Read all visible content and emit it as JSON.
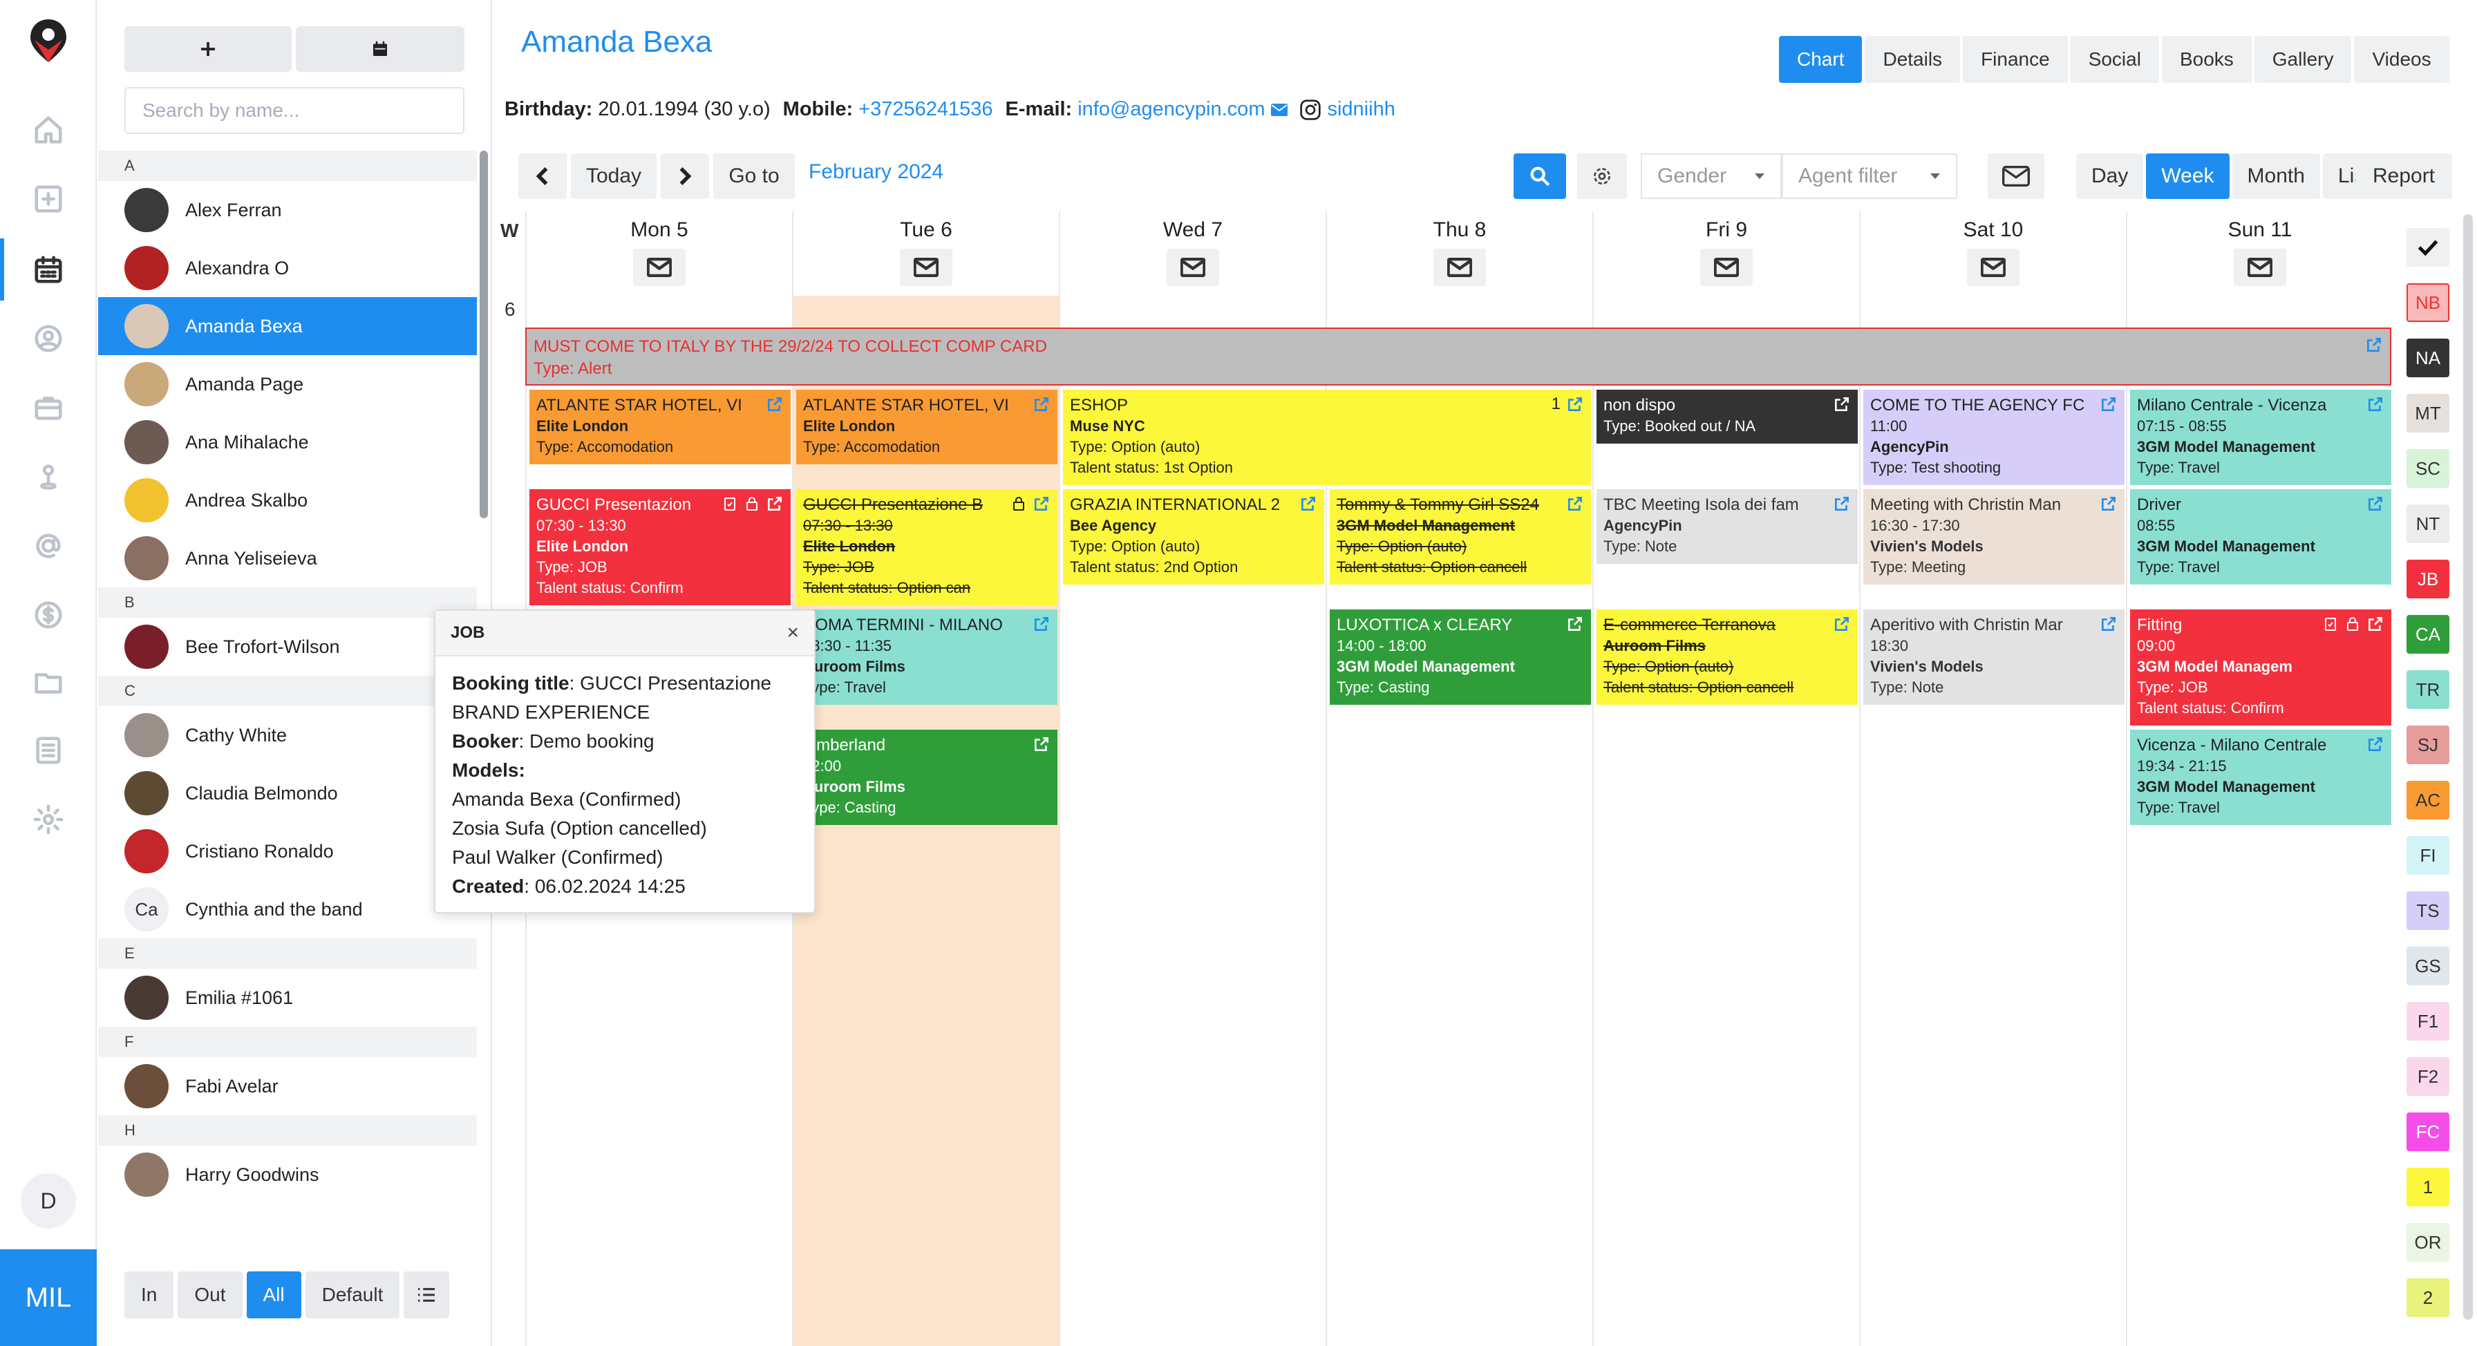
{
  "model_name": "Amanda Bexa",
  "view_tabs": [
    "Chart",
    "Details",
    "Finance",
    "Social",
    "Books",
    "Gallery",
    "Videos"
  ],
  "info": {
    "birthday_label": "Birthday:",
    "birthday": "20.01.1994 (30 y.o)",
    "mobile_label": "Mobile:",
    "mobile": "+37256241536",
    "email_label": "E-mail:",
    "email": "info@agencypin.com",
    "instagram": "sidniihh"
  },
  "sidebar": {
    "search_placeholder": "Search by name...",
    "groups": [
      {
        "letter": "A",
        "models": [
          {
            "name": "Alex Ferran",
            "color": "#3a3a3a"
          },
          {
            "name": "Alexandra O",
            "color": "#b22222"
          },
          {
            "name": "Amanda Bexa",
            "color": "#d9c8b8",
            "selected": true
          },
          {
            "name": "Amanda Page",
            "color": "#c9a87a"
          },
          {
            "name": "Ana Mihalache",
            "color": "#6d5a52"
          },
          {
            "name": "Andrea Skalbo",
            "color": "#f2c12e"
          },
          {
            "name": "Anna Yeliseieva",
            "color": "#8a6f63"
          }
        ]
      },
      {
        "letter": "B",
        "models": [
          {
            "name": "Bee Trofort-Wilson",
            "color": "#7a1f2a"
          }
        ]
      },
      {
        "letter": "C",
        "models": [
          {
            "name": "Cathy White",
            "color": "#9b8f8a"
          },
          {
            "name": "Claudia Belmondo",
            "color": "#5c4a32"
          },
          {
            "name": "Cristiano Ronaldo",
            "color": "#c3272b"
          },
          {
            "name": "Cynthia and the band",
            "initials": "Ca",
            "color": "#eef0f3"
          }
        ]
      },
      {
        "letter": "E",
        "models": [
          {
            "name": "Emilia #1061",
            "color": "#4a3a34"
          }
        ]
      },
      {
        "letter": "F",
        "models": [
          {
            "name": "Fabi Avelar",
            "color": "#6b4f3a"
          }
        ]
      },
      {
        "letter": "H",
        "models": [
          {
            "name": "Harry Goodwins",
            "color": "#8f7666"
          }
        ]
      }
    ],
    "filters": [
      "In",
      "Out",
      "All",
      "Default"
    ],
    "active_filter": "All"
  },
  "rail": {
    "user_initial": "D",
    "office": "MIL"
  },
  "toolbar": {
    "today": "Today",
    "goto": "Go to",
    "month": "February 2024",
    "gender_placeholder": "Gender",
    "agent_placeholder": "Agent filter",
    "views": [
      "Day",
      "Week",
      "Month",
      "List"
    ],
    "active_view": "Week",
    "report": "Report"
  },
  "calendar": {
    "week_letter": "W",
    "week_number": "6",
    "days": [
      "Mon 5",
      "Tue 6",
      "Wed 7",
      "Thu 8",
      "Fri 9",
      "Sat 10",
      "Sun 11"
    ],
    "alert": {
      "title": "MUST COME TO ITALY BY THE 29/2/24 TO COLLECT COMP CARD",
      "type": "Type: Alert"
    },
    "events": [
      {
        "day": 0,
        "slot": 0,
        "cls": "c-orange",
        "lines": [
          "ATLANTE STAR HOTEL, VI",
          "Elite London",
          "Type: Accomodation"
        ],
        "bold": [
          1
        ]
      },
      {
        "day": 1,
        "slot": 0,
        "cls": "c-orange",
        "lines": [
          "ATLANTE STAR HOTEL, VI",
          "Elite London",
          "Type: Accomodation"
        ],
        "bold": [
          1
        ]
      },
      {
        "day": 2,
        "slot": 0,
        "cls": "c-yellow",
        "wide": true,
        "lines": [
          "ESHOP",
          "Muse NYC",
          "Type: Option (auto)",
          "Talent status: 1st Option"
        ],
        "bold": [
          1
        ],
        "badge": "1"
      },
      {
        "day": 4,
        "slot": 0,
        "cls": "c-black",
        "lines": [
          "non dispo",
          "Type: Booked out / NA"
        ]
      },
      {
        "day": 5,
        "slot": 0,
        "cls": "c-lav",
        "lines": [
          "COME TO THE AGENCY FC",
          "11:00",
          "AgencyPin",
          "Type: Test shooting"
        ],
        "bold": [
          2
        ]
      },
      {
        "day": 6,
        "slot": 0,
        "cls": "c-teal",
        "lines": [
          "Milano Centrale - Vicenza",
          "07:15 - 08:55",
          "3GM Model Management",
          "Type: Travel"
        ],
        "bold": [
          2
        ]
      },
      {
        "day": 0,
        "slot": 1,
        "cls": "c-red",
        "lines": [
          "GUCCI Presentazion",
          "07:30 - 13:30",
          "Elite London",
          "Type: JOB",
          "Talent status: Confirm"
        ],
        "bold": [
          2
        ],
        "icons": true
      },
      {
        "day": 1,
        "slot": 1,
        "cls": "c-yellow",
        "strike": true,
        "lines": [
          "GUCCI Presentazione B",
          "07:30 - 13:30",
          "Elite London",
          "Type: JOB",
          "Talent status: Option can"
        ],
        "bold": [
          2
        ],
        "lock": true
      },
      {
        "day": 2,
        "slot": 1,
        "cls": "c-yellow",
        "lines": [
          "GRAZIA INTERNATIONAL 2",
          "Bee Agency",
          "Type: Option (auto)",
          "Talent status: 2nd Option"
        ],
        "bold": [
          1
        ]
      },
      {
        "day": 3,
        "slot": 1,
        "cls": "c-yellow",
        "strike": true,
        "lines": [
          "Tommy & Tommy Girl SS24",
          "3GM Model Management",
          "Type: Option (auto)",
          "Talent status: Option cancell"
        ],
        "bold": [
          1
        ]
      },
      {
        "day": 4,
        "slot": 1,
        "cls": "c-grey",
        "lines": [
          "TBC Meeting Isola dei fam",
          "AgencyPin",
          "Type: Note"
        ],
        "bold": [
          1
        ]
      },
      {
        "day": 5,
        "slot": 1,
        "cls": "c-beige",
        "lines": [
          "Meeting with Christin Man",
          "16:30 - 17:30",
          "Vivien's Models",
          "Type: Meeting"
        ],
        "bold": [
          2
        ]
      },
      {
        "day": 6,
        "slot": 1,
        "cls": "c-teal",
        "lines": [
          "Driver",
          "08:55",
          "3GM Model Management",
          "Type: Travel"
        ],
        "bold": [
          2
        ]
      },
      {
        "day": 1,
        "slot": 2,
        "cls": "c-teal",
        "lines": [
          "ROMA TERMINI - MILANO",
          "08:30 - 11:35",
          "Auroom Films",
          "Type: Travel"
        ],
        "bold": [
          2
        ]
      },
      {
        "day": 3,
        "slot": 2,
        "cls": "c-green",
        "lines": [
          "LUXOTTICA x CLEARY",
          "14:00 - 18:00",
          "3GM Model Management",
          "Type: Casting"
        ],
        "bold": [
          2
        ]
      },
      {
        "day": 4,
        "slot": 2,
        "cls": "c-yellow",
        "strike": true,
        "lines": [
          "E-commerce Terranova",
          "Auroom Films",
          "Type: Option (auto)",
          "Talent status: Option cancell"
        ],
        "bold": [
          1
        ]
      },
      {
        "day": 5,
        "slot": 2,
        "cls": "c-grey",
        "lines": [
          "Aperitivo with Christin Mar",
          "18:30",
          "Vivien's Models",
          "Type: Note"
        ],
        "bold": [
          2
        ]
      },
      {
        "day": 6,
        "slot": 2,
        "cls": "c-red",
        "lines": [
          "Fitting",
          "09:00",
          "3GM Model Managem",
          "Type: JOB",
          "Talent status: Confirm"
        ],
        "bold": [
          2
        ],
        "icons": true
      },
      {
        "day": 1,
        "slot": 3,
        "cls": "c-green",
        "lines": [
          "Timberland",
          "12:00",
          "Auroom Films",
          "Type: Casting"
        ],
        "bold": [
          2
        ]
      },
      {
        "day": 6,
        "slot": 3,
        "cls": "c-teal",
        "lines": [
          "Vicenza - Milano Centrale",
          "19:34 - 21:15",
          "3GM Model Management",
          "Type: Travel"
        ],
        "bold": [
          2
        ]
      }
    ]
  },
  "popup": {
    "title": "JOB",
    "booking_title_label": "Booking title",
    "booking_title": "GUCCI Presentazione",
    "booking_title_2": "BRAND EXPERIENCE",
    "booker_label": "Booker",
    "booker": "Demo booking",
    "models_label": "Models:",
    "models": [
      "Amanda Bexa (Confirmed)",
      "Zosia Sufa (Option cancelled)",
      "Paul Walker (Confirmed)"
    ],
    "created_label": "Created",
    "created": "06.02.2024 14:25"
  },
  "labels": [
    {
      "code": "NB",
      "bg": "#f7b9b9",
      "fg": "#e33",
      "border": "#e33"
    },
    {
      "code": "NA",
      "bg": "#333333",
      "fg": "#ffffff"
    },
    {
      "code": "MT",
      "bg": "#e6e0dc",
      "fg": "#333"
    },
    {
      "code": "SC",
      "bg": "#d7f3d8",
      "fg": "#333"
    },
    {
      "code": "NT",
      "bg": "#ececec",
      "fg": "#333"
    },
    {
      "code": "JB",
      "bg": "#f3313e",
      "fg": "#ffffff"
    },
    {
      "code": "CA",
      "bg": "#2f9e3a",
      "fg": "#ffffff"
    },
    {
      "code": "TR",
      "bg": "#8adfd1",
      "fg": "#333"
    },
    {
      "code": "SJ",
      "bg": "#e79c9c",
      "fg": "#333"
    },
    {
      "code": "AC",
      "bg": "#f99a33",
      "fg": "#333"
    },
    {
      "code": "FI",
      "bg": "#d2f4f7",
      "fg": "#333"
    },
    {
      "code": "TS",
      "bg": "#d6cef8",
      "fg": "#333"
    },
    {
      "code": "GS",
      "bg": "#dfe6ec",
      "fg": "#333"
    },
    {
      "code": "F1",
      "bg": "#fbd7eb",
      "fg": "#333"
    },
    {
      "code": "F2",
      "bg": "#fbd7eb",
      "fg": "#333"
    },
    {
      "code": "FC",
      "bg": "#f54ee8",
      "fg": "#ffffff"
    },
    {
      "code": "1",
      "bg": "#fdf73b",
      "fg": "#333"
    },
    {
      "code": "OR",
      "bg": "#e9f6e3",
      "fg": "#333"
    },
    {
      "code": "2",
      "bg": "#e9f27a",
      "fg": "#333"
    }
  ],
  "colors": {
    "accent": "#1f8df0",
    "tuesday_highlight": "#fde4cd",
    "alert_border": "#e43131"
  }
}
